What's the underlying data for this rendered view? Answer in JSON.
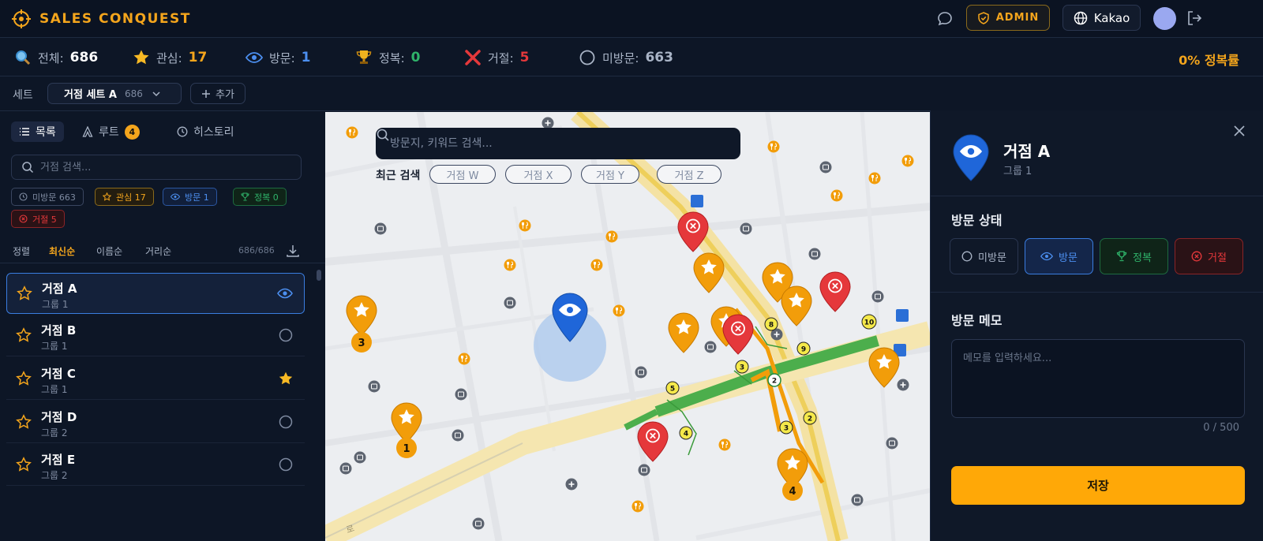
{
  "app": {
    "title": "SALES CONQUEST",
    "admin_label": "ADMIN",
    "provider_label": "Kakao"
  },
  "stats": {
    "total_label": "전체:",
    "total": "686",
    "interest_label": "관심:",
    "interest": "17",
    "visit_label": "방문:",
    "visit": "1",
    "conquer_label": "정복:",
    "conquer": "0",
    "reject_label": "거절:",
    "reject": "5",
    "unvisited_label": "미방문:",
    "unvisited": "663",
    "conquer_rate": "0% 정복률"
  },
  "setbar": {
    "label": "세트",
    "selected": "거점 세트 A",
    "count": "686",
    "add_label": "추가"
  },
  "left": {
    "tabs": [
      {
        "label": "목록"
      },
      {
        "label": "루트",
        "badge": "4"
      },
      {
        "label": "히스토리"
      }
    ],
    "search_placeholder": "거점 검색...",
    "filters": [
      {
        "label": "미방문 663"
      },
      {
        "label": "관심 17"
      },
      {
        "label": "방문 1"
      },
      {
        "label": "정복 0"
      },
      {
        "label": "거절 5"
      }
    ],
    "sort": {
      "label": "정렬",
      "options": [
        "최신순",
        "이름순",
        "거리순"
      ],
      "count": "686/686"
    },
    "items": [
      {
        "name": "거점 A",
        "group": "그룹 1",
        "status": "visit"
      },
      {
        "name": "거점 B",
        "group": "그룹 1",
        "status": "unvisited"
      },
      {
        "name": "거점 C",
        "group": "그룹 1",
        "status": "interest"
      },
      {
        "name": "거점 D",
        "group": "그룹 2",
        "status": "unvisited"
      },
      {
        "name": "거점 E",
        "group": "그룹 2",
        "status": "unvisited"
      }
    ]
  },
  "map": {
    "search_placeholder": "방문지, 키워드 검색...",
    "recent_label": "최근 검색",
    "recent": [
      "거점 W",
      "거점 X",
      "거점 Y",
      "거점 Z"
    ],
    "cluster_counts": [
      "3",
      "1",
      "4"
    ],
    "route_numbers": [
      "8",
      "10",
      "9",
      "3",
      "2",
      "5",
      "4",
      "3",
      "2"
    ],
    "street_label": "로"
  },
  "detail": {
    "name": "거점 A",
    "group": "그룹 1",
    "status_title": "방문 상태",
    "statuses": [
      "미방문",
      "방문",
      "정복",
      "거절"
    ],
    "memo_title": "방문 메모",
    "memo_placeholder": "메모를 입력하세요...",
    "memo_count": "0 / 500",
    "save_label": "저장"
  },
  "colors": {
    "accent": "#ffa807",
    "visit": "#3a7de0",
    "conquer": "#2fb36a",
    "reject": "#e5383b",
    "bg": "#0d1626"
  }
}
